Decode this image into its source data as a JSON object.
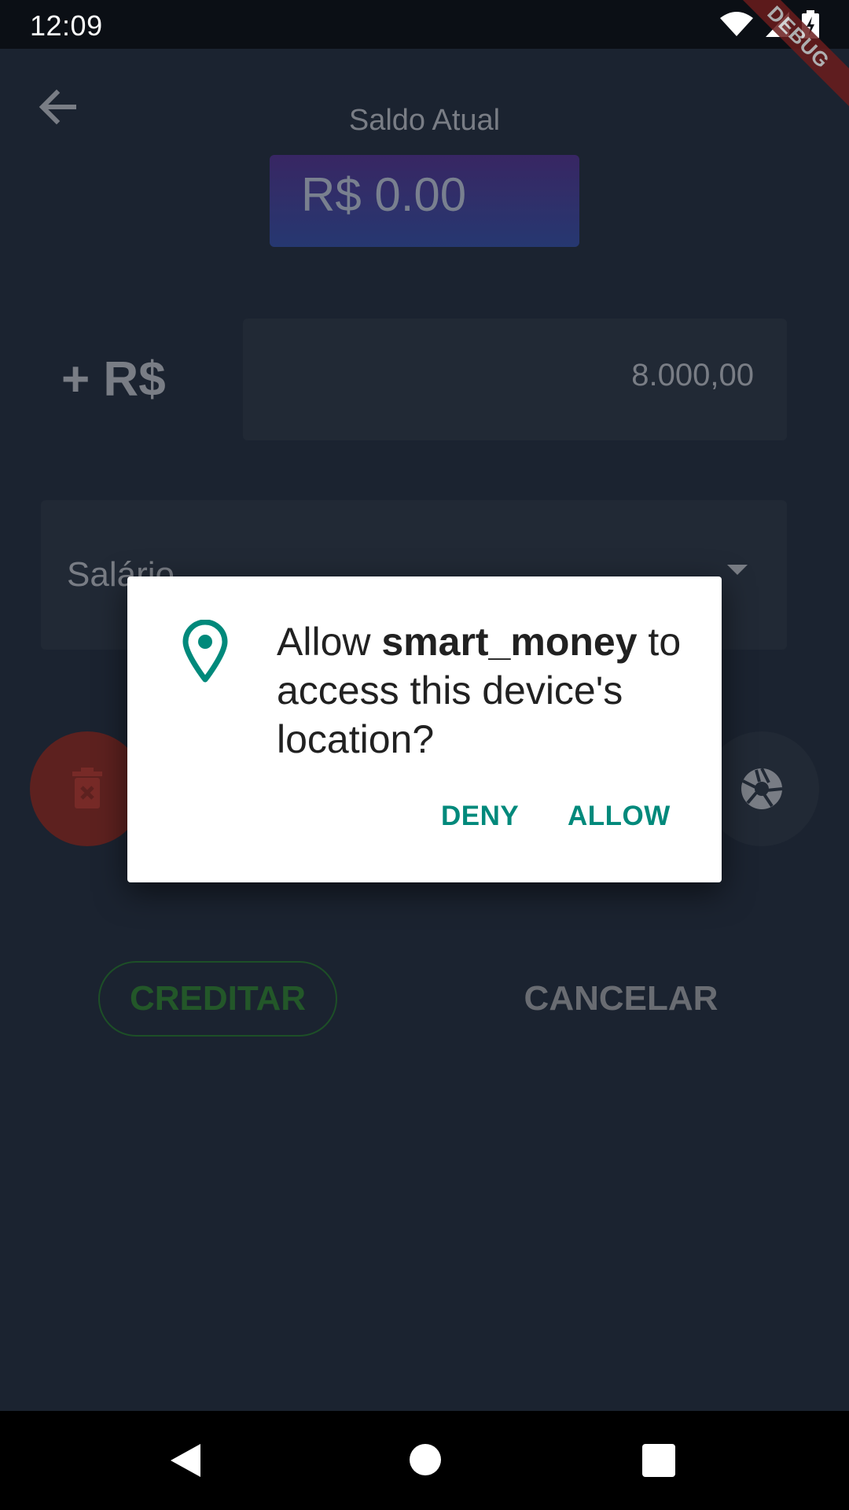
{
  "status_bar": {
    "time": "12:09"
  },
  "debug_banner": "DEBUG",
  "screen": {
    "balance_label": "Saldo Atual",
    "balance_value": "R$ 0.00",
    "amount_prefix": "+ R$",
    "amount_value": "8.000,00",
    "category_value": "Salário",
    "credit_button": "CREDITAR",
    "cancel_button": "CANCELAR"
  },
  "dialog": {
    "message_prefix": "Allow ",
    "app_name": "smart_money",
    "message_suffix": " to access this device's location?",
    "deny_label": "DENY",
    "allow_label": "ALLOW",
    "accent_color": "#00897b"
  },
  "icons": {
    "back": "arrow-left-icon",
    "delete": "trash-icon",
    "camera": "camera-shutter-icon",
    "location": "location-pin-icon"
  }
}
